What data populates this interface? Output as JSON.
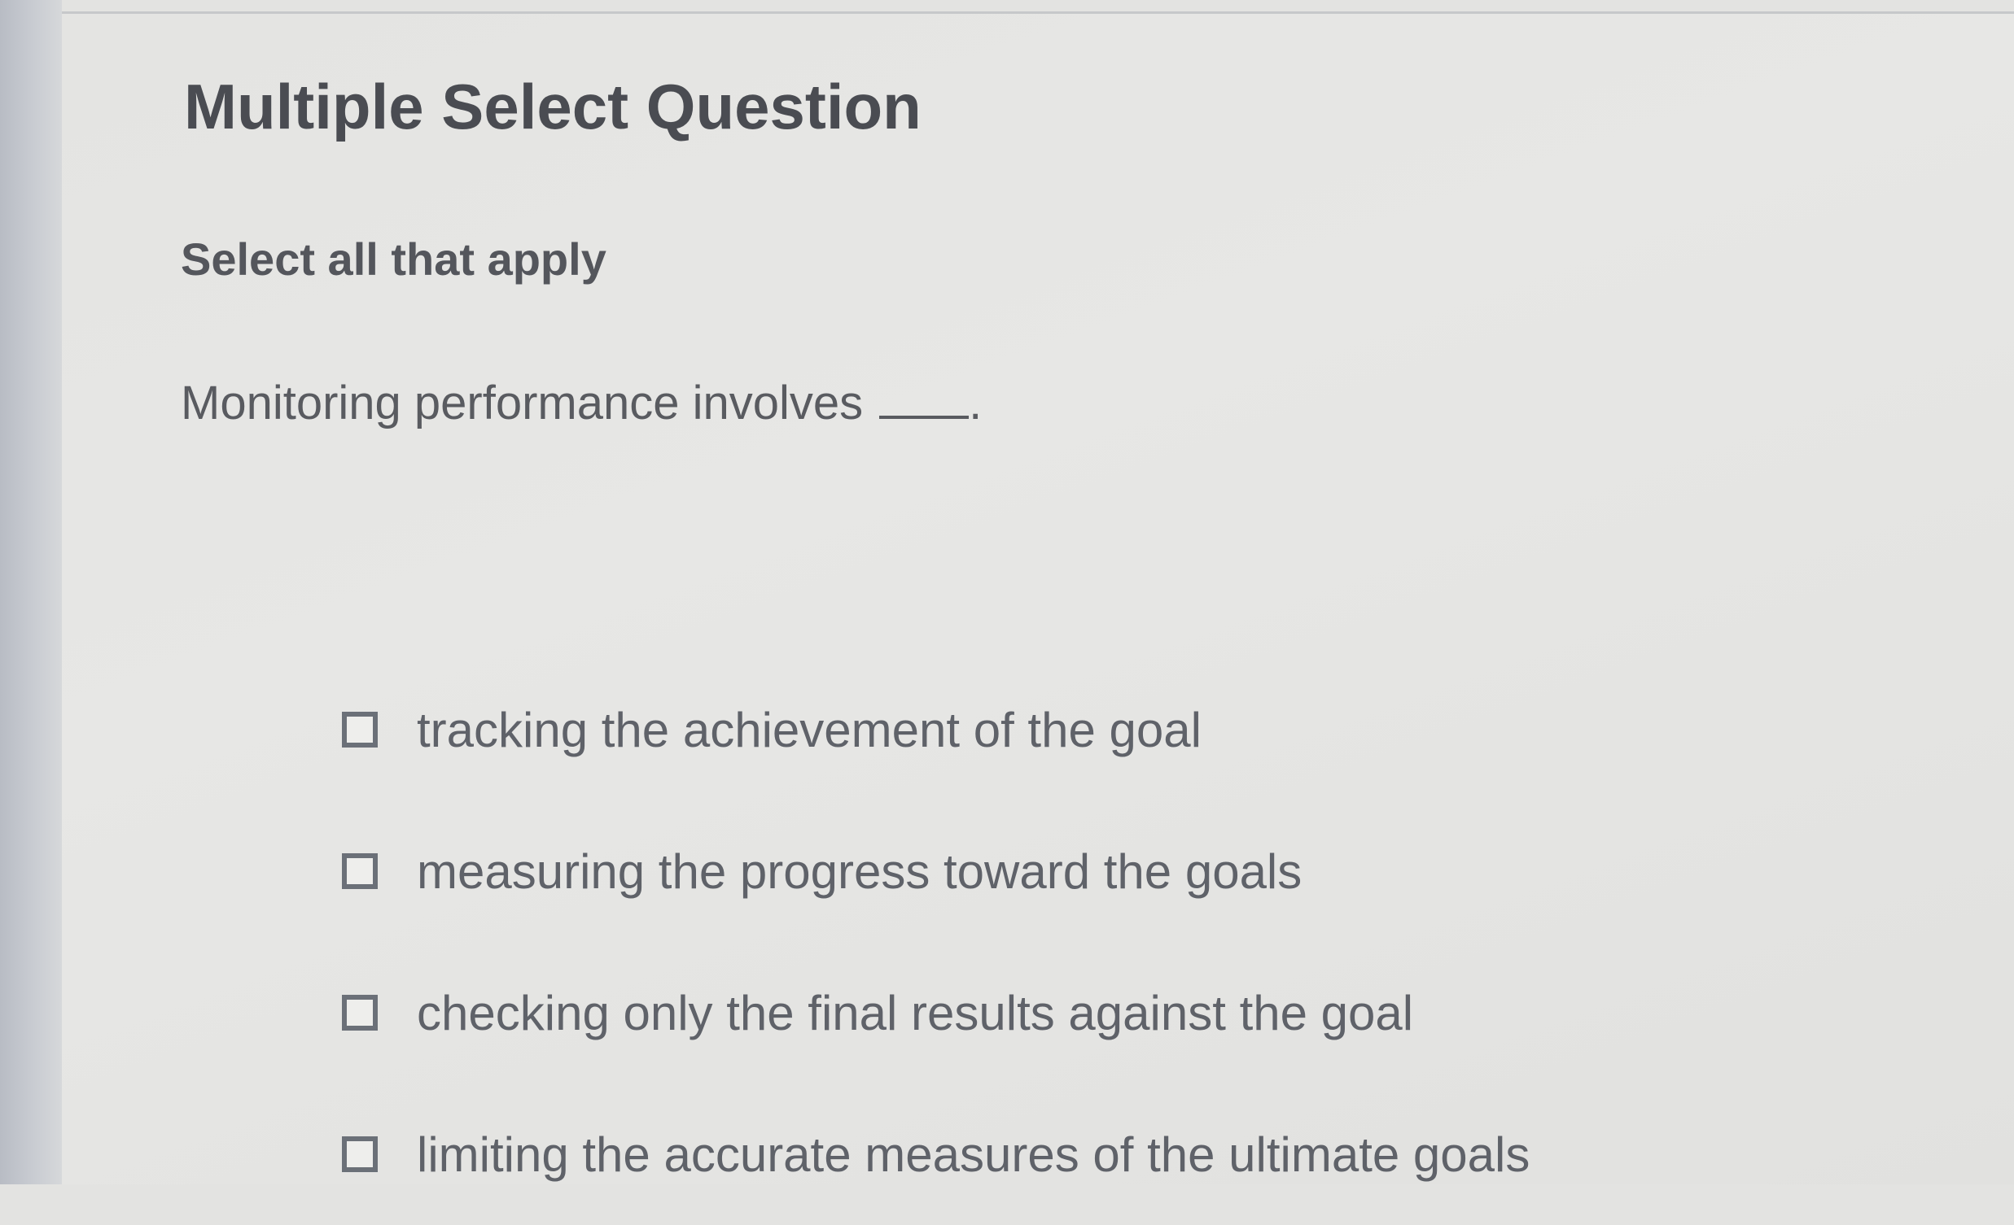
{
  "question": {
    "heading": "Multiple Select Question",
    "instruction": "Select all that apply",
    "prompt": "Monitoring performance involves",
    "prompt_end": ".",
    "options": [
      {
        "label": "tracking the achievement of the goal",
        "checked": false
      },
      {
        "label": "measuring the progress toward the goals",
        "checked": false
      },
      {
        "label": "checking only the final results against the goal",
        "checked": false
      },
      {
        "label": "limiting the accurate measures of the ultimate goals",
        "checked": false
      }
    ]
  }
}
